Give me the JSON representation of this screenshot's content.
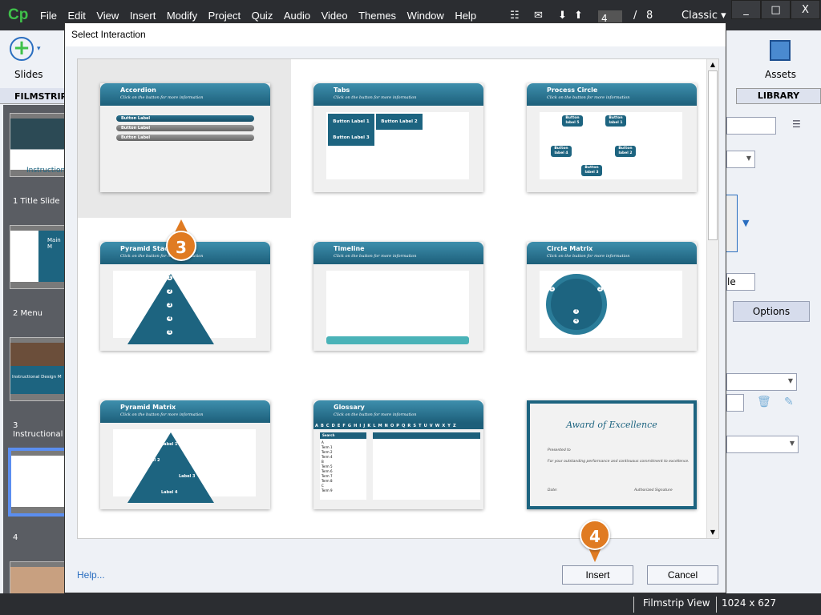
{
  "app": {
    "logo": "Cp",
    "menu": [
      "File",
      "Edit",
      "View",
      "Insert",
      "Modify",
      "Project",
      "Quiz",
      "Audio",
      "Video",
      "Themes",
      "Window",
      "Help"
    ],
    "current_page": "4",
    "page_sep": "/",
    "total_pages": "8",
    "workspace": "Classic",
    "window_controls": [
      "_",
      "□",
      "X"
    ]
  },
  "left_panel": {
    "slides_label": "Slides",
    "filmstrip_tab": "FILMSTRIP",
    "slides": [
      {
        "label": "1 Title Slide",
        "preview": "Instruction"
      },
      {
        "label": "2 Menu",
        "preview": "Main M"
      },
      {
        "label": "3 Instructional",
        "preview": "Instructional Design M"
      },
      {
        "label": "4",
        "preview": ""
      }
    ]
  },
  "right_panel": {
    "assets_label": "Assets",
    "library_tab": "LIBRARY",
    "options_tab": "Options",
    "field_text": "le"
  },
  "status": {
    "view": "Filmstrip View",
    "size": "1024 x 627"
  },
  "dialog": {
    "title": "Select Interaction",
    "help": "Help...",
    "insert": "Insert",
    "cancel": "Cancel",
    "subtitle": "Click on the button for more information",
    "interactions": [
      {
        "title": "Accordion",
        "items": [
          "Button Label",
          "Button Label",
          "Button Label"
        ]
      },
      {
        "title": "Tabs",
        "items": [
          "Button Label 1",
          "Button Label 2",
          "Button Label 3"
        ]
      },
      {
        "title": "Process Circle",
        "items": [
          "Button label 5",
          "Button label 1",
          "Button label 2",
          "Button label 3",
          "Button label 4"
        ]
      },
      {
        "title": "Pyramid Stack",
        "items": [
          "1",
          "2",
          "3",
          "4",
          "5"
        ]
      },
      {
        "title": "Timeline",
        "items": []
      },
      {
        "title": "Circle Matrix",
        "items": [
          "1",
          "2",
          "3",
          "4"
        ]
      },
      {
        "title": "Pyramid Matrix",
        "items": [
          "Label 1",
          "Label 2",
          "Label 3",
          "Label 4"
        ]
      },
      {
        "title": "Glossary",
        "letters": "ABCDEFGHIJKLMNOPQRSTUVWXYZ",
        "search": "Search",
        "items": [
          "A",
          "Term 1",
          "Term 2",
          "Term 4",
          "B",
          "Term 5",
          "Term 6",
          "Term 7",
          "Term 8",
          "C",
          "Term 9"
        ]
      },
      {
        "title": "Award of Excellence",
        "items": [
          "Presented to",
          "For your outstanding performance and continuous commitment to excellence.",
          "Date:",
          "Authorized Signature"
        ]
      }
    ],
    "selected_index": 0
  },
  "callouts": [
    "3",
    "4"
  ],
  "colors": {
    "accent": "#1d6480",
    "callout": "#e07b22",
    "selection": "#5b8ef0"
  }
}
